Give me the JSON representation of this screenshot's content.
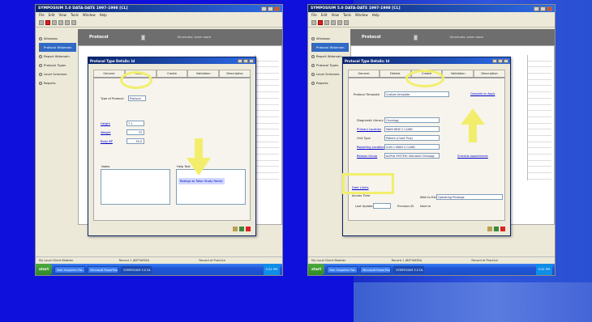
{
  "colors": {
    "slide_background": "#1010dc",
    "highlight": "#f2ee6c",
    "titlebar_blue": "#0a246a",
    "taskbar_blue": "#245edb",
    "start_green": "#3a9a34"
  },
  "left_screenshot": {
    "window_title": "SYMPOSIUM 5.0 DATA-DATE 1997-1998 [CL]",
    "menu": [
      "File",
      "Edit",
      "View",
      "Tools",
      "Window",
      "Help"
    ],
    "sidebar": [
      "Windows",
      "Protocol Wdomain",
      "Report Wdomain",
      "Protocol Types",
      "Level Schemes",
      "Reports"
    ],
    "banner_title": "Protocol",
    "banner_link": "Structures: Learn more",
    "dialog_title": "Protocol Type Details: Id",
    "tabs": [
      "General",
      "Details",
      "Create",
      "Validation",
      "Description"
    ],
    "fields": [
      {
        "label": "Type of Protocol",
        "value": "Protocol"
      },
      {
        "label": "Height",
        "value": "7 2"
      },
      {
        "label": "Weight",
        "value": "75"
      },
      {
        "label": "Body BP",
        "value": "50.0"
      }
    ],
    "notes_label": "Notes",
    "help_label": "Help Text",
    "help_text": "Ratings to Tailor Study Factor",
    "status": [
      "My Local Client Bladder",
      "Record 1 (BETWEEN)",
      "Record of Practice"
    ],
    "taskbar": [
      "start",
      "Mail Simplifier Pat...",
      "Microsoft PowerPoint...",
      "SYMPOSIUM 5.0 DL..."
    ],
    "tray_time": "3:22 PM"
  },
  "right_screenshot": {
    "window_title": "SYMPOSIUM 5.0 DATA-DATE 1997-1998 [CL]",
    "menu": [
      "File",
      "Edit",
      "View",
      "Tools",
      "Window",
      "Help"
    ],
    "sidebar": [
      "Windows",
      "Protocol Wdomain",
      "Report Wdomain",
      "Protocol Types",
      "Level Schemes",
      "Reports"
    ],
    "banner_title": "Protocol",
    "banner_link": "Structures: Learn more",
    "dialog_title": "Protocol Type Details: Id",
    "tabs": [
      "General",
      "Details",
      "Create",
      "Validation",
      "Description"
    ],
    "fields": [
      {
        "label": "Protocol Template",
        "value": "Custom template"
      },
      {
        "label": "Diagnostic Library",
        "value": "Oncology"
      },
      {
        "label": "Primary Location",
        "value": "MAIN NEW 2 CLINIC"
      },
      {
        "label": "Unit Type",
        "value": "Patient (Chart Plus)"
      },
      {
        "label": "Reporting Location",
        "value": "CLIN 1 MAIN 3 CLINIC"
      },
      {
        "label": "Reason Group",
        "value": "ALPHA SYSTEM: Standard Ontology"
      }
    ],
    "checkbox_label": "Complete on Apply",
    "side_link": "Schedule appointments",
    "bottom_links": [
      "Date Limits",
      "Access Time"
    ],
    "bottom_fields": [
      {
        "label": "Wait to Extend",
        "value": "Operating Privilege"
      },
      {
        "label": "Next to",
        "value": ""
      }
    ],
    "bottom_left_labels": [
      "Last Update",
      "Previous ID"
    ],
    "status": [
      "My Local Client Bladder",
      "Record 1 (BETWEEN)",
      "Record of Practice"
    ],
    "taskbar": [
      "start",
      "Mail Simplifier Pat...",
      "Microsoft PowerPoint...",
      "SYMPOSIUM 5.0 DL..."
    ],
    "tray_time": "3:22 PM"
  }
}
